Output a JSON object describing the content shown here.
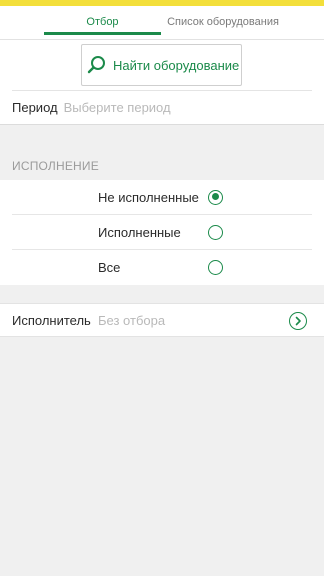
{
  "tabs": [
    {
      "label": "Отбор",
      "active": true
    },
    {
      "label": "Список оборудования",
      "active": false
    }
  ],
  "find": {
    "label": "Найти оборудование",
    "icon": "search-icon"
  },
  "period": {
    "label": "Период",
    "placeholder": "Выберите период"
  },
  "execution": {
    "header": "ИСПОЛНЕНИЕ",
    "options": [
      {
        "label": "Не исполненные",
        "selected": true
      },
      {
        "label": "Исполненные",
        "selected": false
      },
      {
        "label": "Все",
        "selected": false
      }
    ]
  },
  "executor": {
    "label": "Исполнитель",
    "value": "Без отбора",
    "icon": "chevron-right-icon"
  },
  "colors": {
    "accent": "#1b8a4a",
    "statusbar": "#f3df3b",
    "background": "#f0f0f0"
  }
}
